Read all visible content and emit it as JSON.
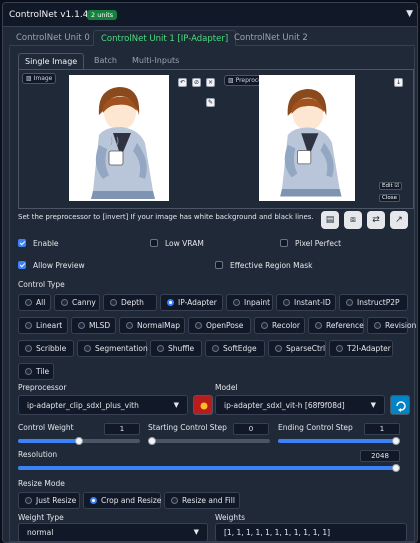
{
  "header": {
    "title": "ControlNet v1.1.449",
    "badge": "2 units"
  },
  "unit_tabs": [
    "ControlNet Unit 0",
    "ControlNet Unit 1 [IP-Adapter]",
    "ControlNet Unit 2"
  ],
  "image_tabs": [
    "Single Image",
    "Batch",
    "Multi-Inputs"
  ],
  "image_panel": {
    "image_label": "Image",
    "preview_label": "Preprocessor Preview",
    "edit_label": "Edit",
    "close_label": "Close"
  },
  "note": "Set the preprocessor to [invert] If your image has white background and black lines.",
  "options": {
    "enable": "Enable",
    "low_vram": "Low VRAM",
    "pixel_perfect": "Pixel Perfect",
    "allow_preview": "Allow Preview",
    "effective_region_mask": "Effective Region Mask"
  },
  "control_type": {
    "label": "Control Type",
    "row1": [
      "All",
      "Canny",
      "Depth",
      "IP-Adapter",
      "Inpaint",
      "Instant-ID",
      "InstructP2P"
    ],
    "row2": [
      "Lineart",
      "MLSD",
      "NormalMap",
      "OpenPose",
      "Recolor",
      "Reference",
      "Revision"
    ],
    "row3": [
      "Scribble",
      "Segmentation",
      "Shuffle",
      "SoftEdge",
      "SparseCtrl",
      "T2I-Adapter"
    ],
    "row4": [
      "Tile"
    ],
    "selected": "IP-Adapter"
  },
  "preprocessor": {
    "label": "Preprocessor",
    "value": "ip-adapter_clip_sdxl_plus_vith"
  },
  "model": {
    "label": "Model",
    "value": "ip-adapter_sdxl_vit-h [68f9f08d]"
  },
  "sliders": {
    "control_weight": {
      "label": "Control Weight",
      "value": "1",
      "fraction": 0.5
    },
    "start_step": {
      "label": "Starting Control Step",
      "value": "0",
      "fraction": 0.0
    },
    "end_step": {
      "label": "Ending Control Step",
      "value": "1",
      "fraction": 1.0
    },
    "resolution": {
      "label": "Resolution",
      "value": "2048",
      "fraction": 1.0
    }
  },
  "resize_mode": {
    "label": "Resize Mode",
    "options": [
      "Just Resize",
      "Crop and Resize",
      "Resize and Fill"
    ],
    "selected": "Crop and Resize"
  },
  "weight_type": {
    "label": "Weight Type",
    "value": "normal"
  },
  "weights": {
    "label": "Weights",
    "value": "[1, 1, 1, 1, 1, 1, 1, 1, 1, 1, 1]"
  },
  "colors": {
    "accent": "#3b82f6",
    "active_tab": "#4ade80",
    "badge": "#15803d",
    "run_button": "#b91c1c",
    "refresh_button": "#0284c7"
  }
}
